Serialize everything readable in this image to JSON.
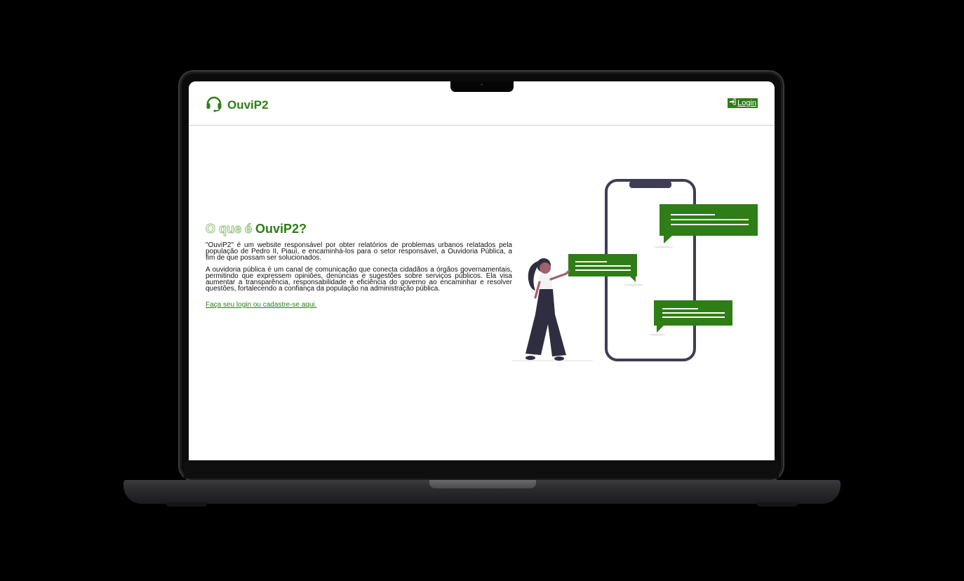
{
  "app": {
    "brand_name": "OuviP2",
    "login_label": "Login",
    "colors": {
      "brand_green": "#2e7d16",
      "bubble_green": "#2e7d16",
      "phone_outline": "#3f3d56"
    }
  },
  "hero": {
    "heading_part1": "O que é",
    "heading_part2": "OuviP2?",
    "paragraph1": "\"OuviP2\" é um website responsável por obter relatórios de problemas urbanos relatados pela população de Pedro II, Piauí, e encaminhá-los para o setor responsável, a Ouvidoria Pública, a fim de que possam ser solucionados.",
    "paragraph2": "A ouvidoria pública é um canal de comunicação que conecta cidadãos a órgãos governamentais, permitindo que expressem opiniões, denúncias e sugestões sobre serviços públicos. Ela visa aumentar a transparência, responsabilidade e eficiência do governo ao encaminhar e resolver questões, fortalecendo a confiança da população na administração pública.",
    "cta_link": "Faça seu login ou cadastre-se aqui."
  },
  "icons": {
    "brand": "headset-icon",
    "login": "sign-in-icon"
  }
}
